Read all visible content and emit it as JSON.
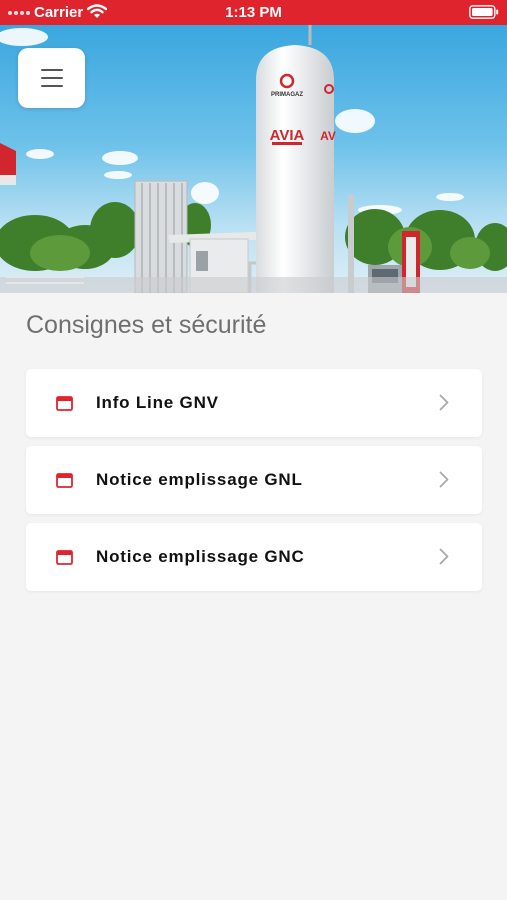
{
  "status_bar": {
    "carrier": "Carrier",
    "time": "1:13 PM"
  },
  "hero": {
    "menu_icon": "hamburger-menu-icon",
    "logo_primagaz": "PRIMAGAZ",
    "logo_avia": "AVIA"
  },
  "section": {
    "title": "Consignes et sécurité"
  },
  "items": [
    {
      "label": "Info Line GNV",
      "icon": "document-window-icon"
    },
    {
      "label": "Notice emplissage GNL",
      "icon": "document-window-icon"
    },
    {
      "label": "Notice emplissage GNC",
      "icon": "document-window-icon"
    }
  ],
  "colors": {
    "status_bar": "#e0242e",
    "accent": "#e0242e",
    "background": "#f4f4f4",
    "title_text": "#6f6f6f"
  }
}
